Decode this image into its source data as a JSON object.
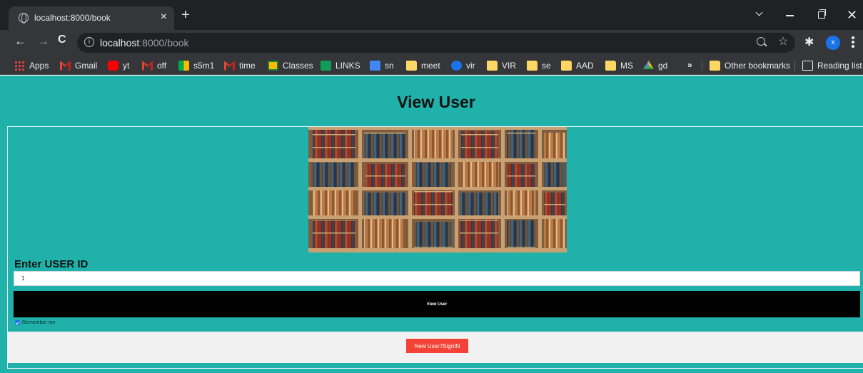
{
  "browser": {
    "tab_title": "localhost:8000/book",
    "url_host": "localhost",
    "url_path": ":8000/book",
    "profile_initial": "x"
  },
  "bookmarks": [
    {
      "label": "Apps",
      "icon": "apps-grid-icon"
    },
    {
      "label": "Gmail",
      "icon": "gmail-icon"
    },
    {
      "label": "yt",
      "icon": "youtube-icon"
    },
    {
      "label": "off",
      "icon": "gmail-icon"
    },
    {
      "label": "s5m1",
      "icon": "meet-icon"
    },
    {
      "label": "time",
      "icon": "gmail-icon"
    },
    {
      "label": "Classes",
      "icon": "classroom-icon"
    },
    {
      "label": "LINKS",
      "icon": "sheets-icon"
    },
    {
      "label": "sn",
      "icon": "docs-icon"
    },
    {
      "label": "meet",
      "icon": "folder-icon"
    },
    {
      "label": "vir",
      "icon": "c-logo-icon"
    },
    {
      "label": "VIR",
      "icon": "folder-icon"
    },
    {
      "label": "se",
      "icon": "folder-icon"
    },
    {
      "label": "AAD",
      "icon": "folder-icon"
    },
    {
      "label": "MS",
      "icon": "folder-icon"
    },
    {
      "label": "gd",
      "icon": "drive-icon"
    }
  ],
  "bookmarks_more": "»",
  "other_bookmarks": "Other bookmarks",
  "reading_list": "Reading list",
  "page": {
    "title": "View User",
    "user_id_label": "Enter USER ID",
    "user_id_value": "1",
    "view_button": "View User",
    "remember_label": "Remember me",
    "remember_checked": true,
    "signin_button": "New User?SignIN",
    "colors": {
      "background": "#20b2aa",
      "button": "#000000",
      "signin": "#f44336",
      "footer": "#f1f1f1"
    }
  }
}
